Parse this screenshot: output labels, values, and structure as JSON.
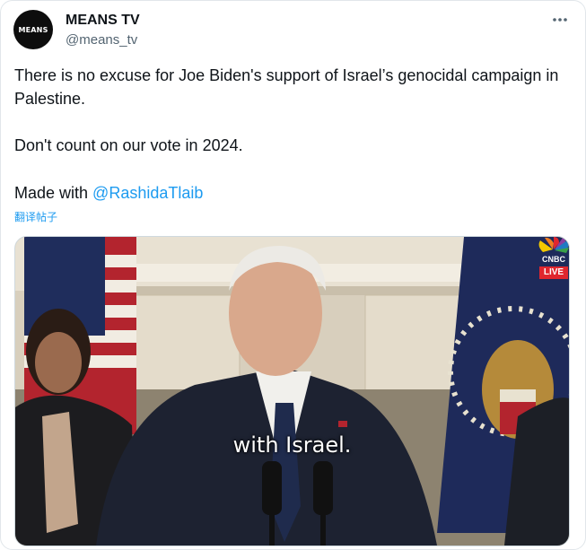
{
  "author": {
    "name": "MEANS TV",
    "handle": "@means_tv",
    "avatar_text": "MEANS"
  },
  "more_icon": "more-dots-icon",
  "tweet": {
    "paragraph1": "There is no excuse for Joe Biden's support of Israel’s genocidal campaign in Palestine.",
    "paragraph2": "Don't count on our vote in 2024.",
    "paragraph3_prefix": "Made with ",
    "mention": "@RashidaTlaib",
    "translate_label": "翻译帖子"
  },
  "media": {
    "caption": "with Israel.",
    "channel_logo_text": "CNBC",
    "live_badge": "LIVE"
  },
  "colors": {
    "link": "#1d9bf0",
    "text": "#0f1419",
    "secondary": "#536471",
    "live_red": "#e0262e"
  }
}
